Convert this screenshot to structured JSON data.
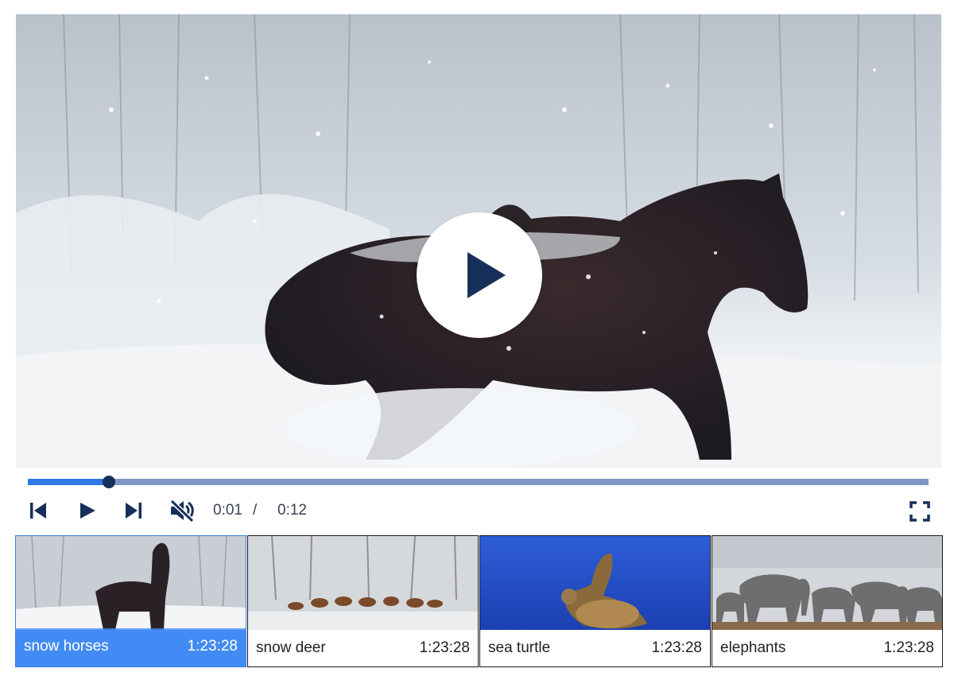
{
  "player": {
    "video_title": "snow horses",
    "progress_fraction": 0.09,
    "current_time": "0:01",
    "separator": "/",
    "duration": "0:12",
    "muted": true
  },
  "icons": {
    "big_play": "play-icon",
    "previous": "skip-previous-icon",
    "play": "play-icon",
    "next": "skip-next-icon",
    "volume": "volume-muted-icon",
    "fullscreen": "fullscreen-icon"
  },
  "colors": {
    "accent": "#2f7ae5",
    "track": "#7d98c7",
    "icon": "#17305a",
    "active_tile": "#3b86ef"
  },
  "playlist": [
    {
      "title": "snow horses",
      "duration": "1:23:28",
      "active": true
    },
    {
      "title": "snow deer",
      "duration": "1:23:28",
      "active": false
    },
    {
      "title": "sea turtle",
      "duration": "1:23:28",
      "active": false
    },
    {
      "title": "elephants",
      "duration": "1:23:28",
      "active": false
    }
  ]
}
